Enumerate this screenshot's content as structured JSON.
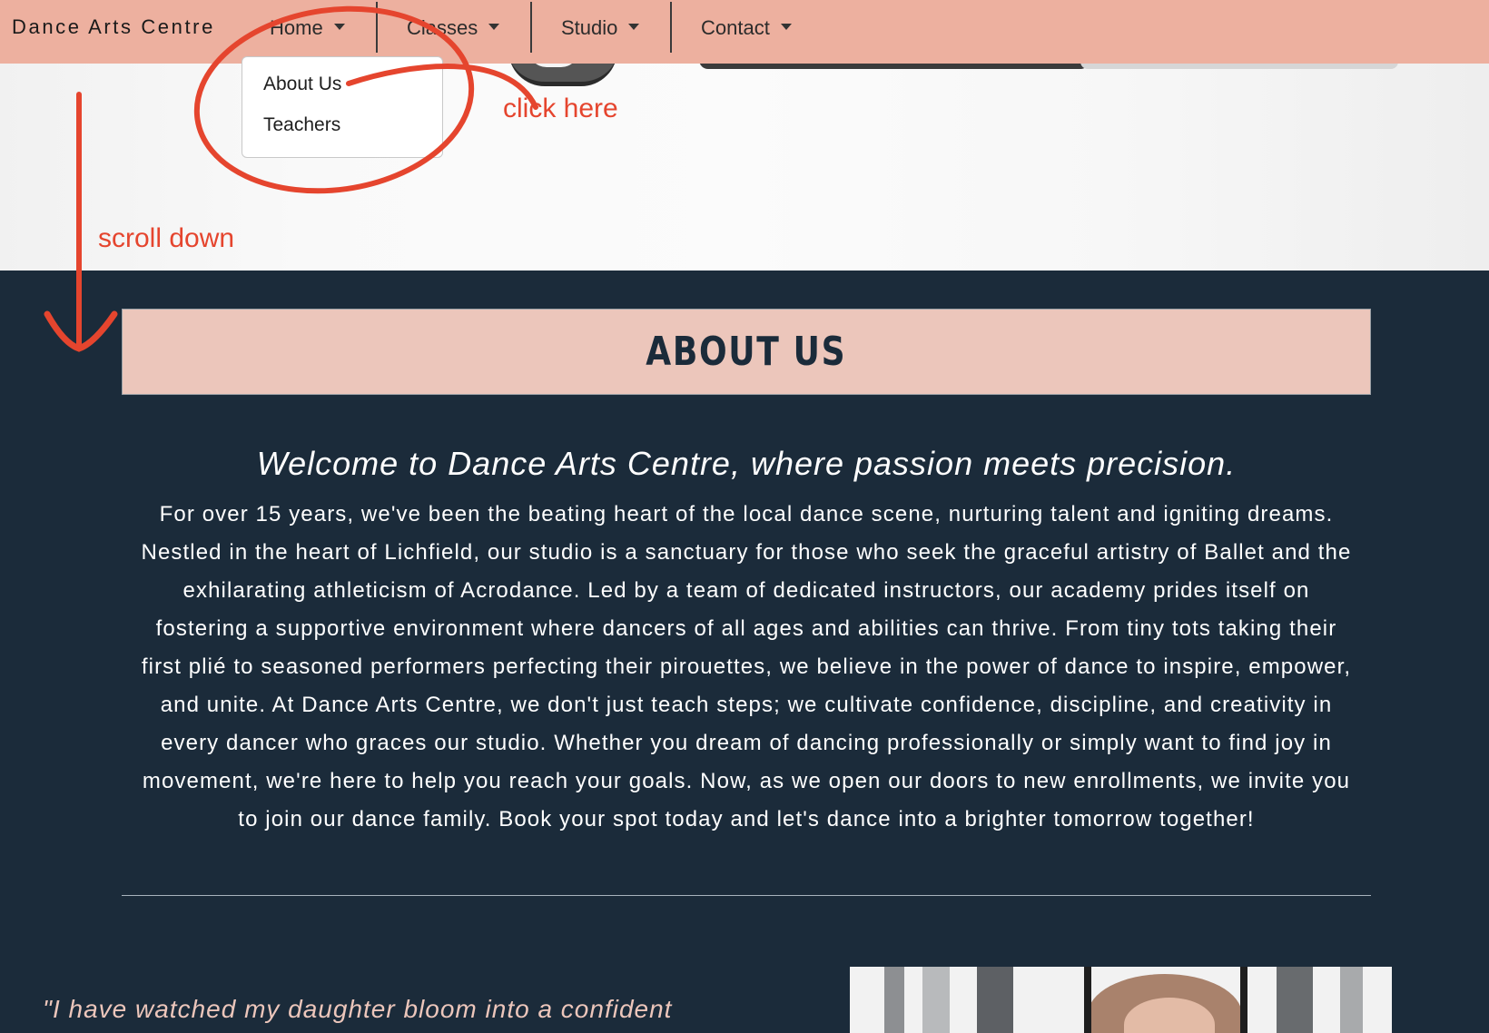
{
  "navbar": {
    "brand": "Dance Arts Centre",
    "items": [
      {
        "label": "Home"
      },
      {
        "label": "Classes"
      },
      {
        "label": "Studio"
      },
      {
        "label": "Contact"
      }
    ]
  },
  "dropdown": {
    "items": [
      {
        "label": "About Us"
      },
      {
        "label": "Teachers"
      }
    ]
  },
  "annotations": {
    "click_hint": "click here",
    "scroll_hint": "scroll down"
  },
  "about": {
    "title": "ABOUT US",
    "welcome": "Welcome to Dance Arts Centre, where passion meets precision.",
    "body": "For over 15 years, we've been the beating heart of the local dance scene, nurturing talent and igniting dreams. Nestled in the heart of Lichfield, our studio is a sanctuary for those who seek the graceful artistry of Ballet and the exhilarating athleticism of Acrodance. Led by a team of dedicated instructors, our academy prides itself on fostering a supportive environment where dancers of all ages and abilities can thrive. From tiny tots taking their first plié to seasoned performers perfecting their pirouettes, we believe in the power of dance to inspire, empower, and unite. At Dance Arts Centre, we don't just teach steps; we cultivate confidence, discipline, and creativity in every dancer who graces our studio. Whether you dream of dancing professionally or simply want to find joy in movement, we're here to help you reach your goals. Now, as we open our doors to new enrollments, we invite you to join our dance family. Book your spot today and let's dance into a brighter tomorrow together!"
  },
  "testimonial": {
    "quote": "\"I have watched my daughter bloom into a confident"
  },
  "colors": {
    "navbar": "#edb09f",
    "page_background": "#1b2b3a",
    "banner": "#ecc6bb",
    "annotation": "#e5452e"
  }
}
